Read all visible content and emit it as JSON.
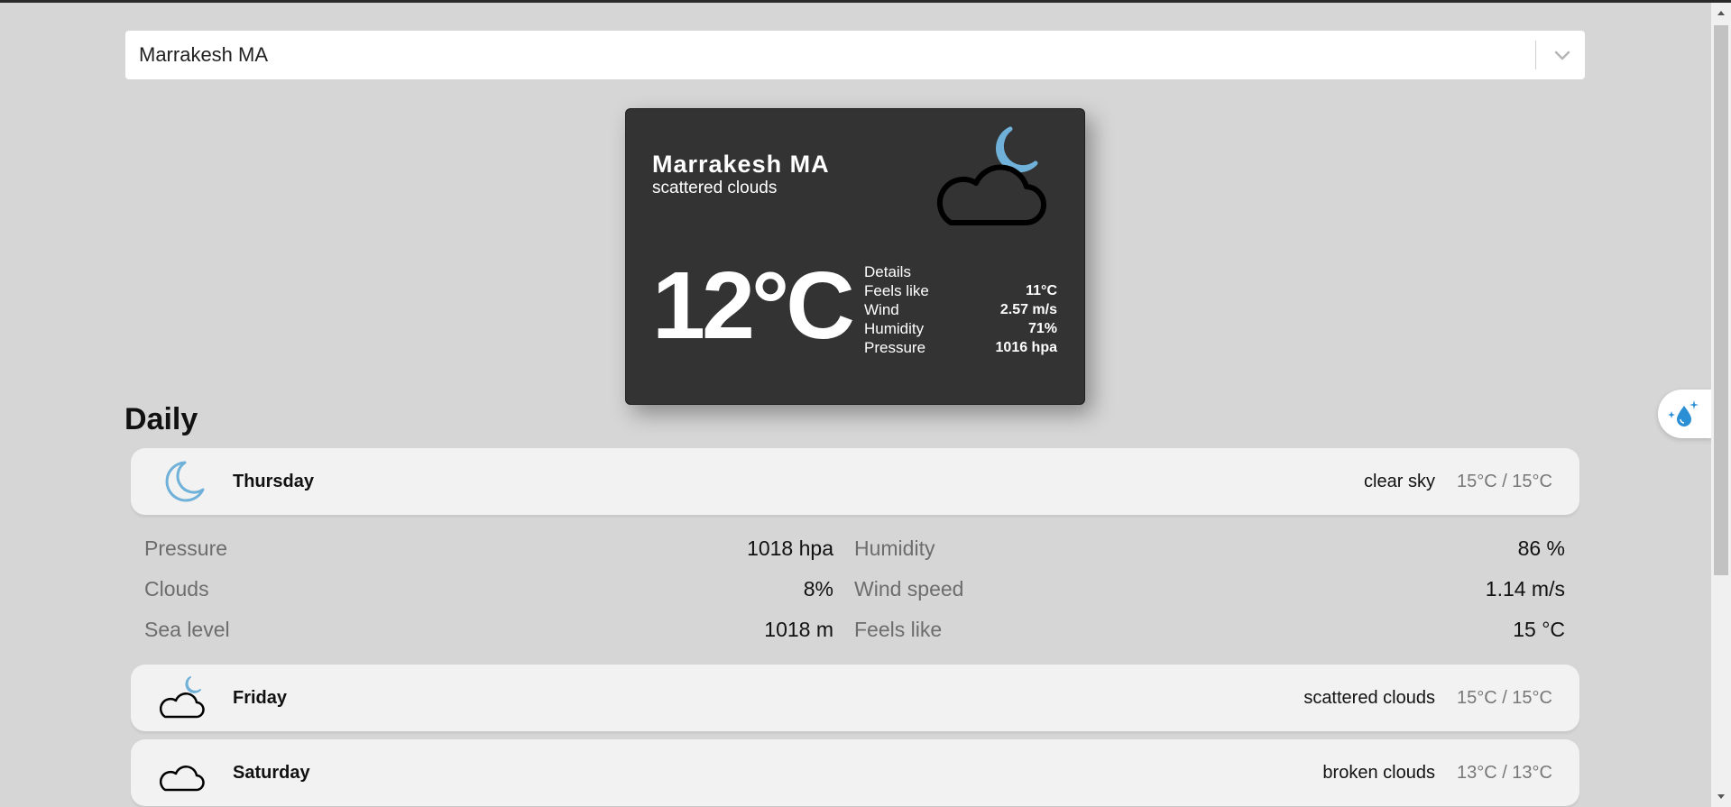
{
  "search": {
    "value": "Marrakesh MA"
  },
  "current": {
    "city": "Marrakesh MA",
    "description": "scattered clouds",
    "temperature": "12°C",
    "icon": "moon-cloud-icon",
    "details_title": "Details",
    "details": [
      {
        "label": "Feels like",
        "value": "11°C"
      },
      {
        "label": "Wind",
        "value": "2.57 m/s"
      },
      {
        "label": "Humidity",
        "value": "71%"
      },
      {
        "label": "Pressure",
        "value": "1016 hpa"
      }
    ]
  },
  "daily": {
    "title": "Daily",
    "days": [
      {
        "name": "Thursday",
        "description": "clear sky",
        "temps": "15°C / 15°C",
        "icon": "moon-icon"
      },
      {
        "name": "Friday",
        "description": "scattered clouds",
        "temps": "15°C / 15°C",
        "icon": "moon-cloud-icon"
      },
      {
        "name": "Saturday",
        "description": "broken clouds",
        "temps": "13°C / 13°C",
        "icon": "cloud-icon"
      }
    ],
    "expanded": {
      "left": [
        {
          "label": "Pressure",
          "value": "1018 hpa"
        },
        {
          "label": "Clouds",
          "value": "8%"
        },
        {
          "label": "Sea level",
          "value": "1018 m"
        }
      ],
      "right": [
        {
          "label": "Humidity",
          "value": "86 %"
        },
        {
          "label": "Wind speed",
          "value": "1.14 m/s"
        },
        {
          "label": "Feels like",
          "value": "15 °C"
        }
      ]
    }
  },
  "colors": {
    "background": "#d6d6d6",
    "card": "#333333",
    "accent": "#6fb1d8"
  },
  "widget": {
    "icon": "water-sparkle-icon"
  }
}
